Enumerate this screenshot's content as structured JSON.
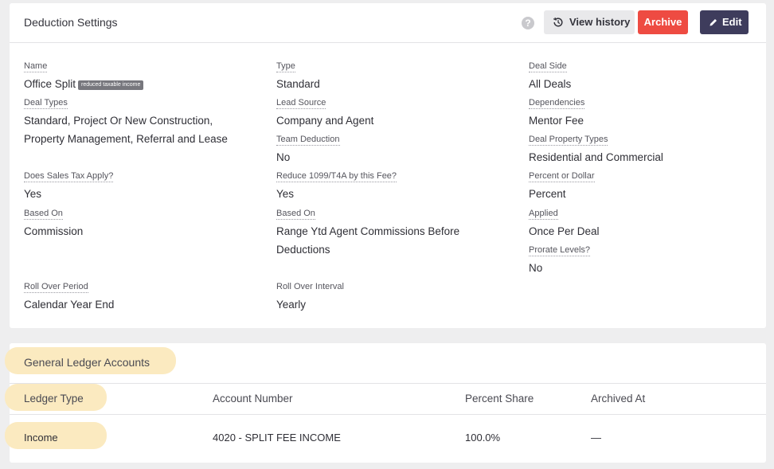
{
  "settings": {
    "title": "Deduction Settings",
    "help_glyph": "?",
    "view_history_label": "View history",
    "archive_label": "Archive",
    "edit_label": "Edit",
    "colors": {
      "archive": "#ee4b42",
      "edit": "#3e3c5c",
      "highlight": "#fbeac0"
    },
    "fields": {
      "name": {
        "label": "Name",
        "value": "Office Split",
        "tag": "reduced taxable income"
      },
      "type": {
        "label": "Type",
        "value": "Standard"
      },
      "deal_side": {
        "label": "Deal Side",
        "value": "All Deals"
      },
      "deal_types": {
        "label": "Deal Types",
        "value_line1": "Standard, Project Or New Construction,",
        "value_line2": "Property Management, Referral and Lease"
      },
      "lead_source": {
        "label": "Lead Source",
        "value": "Company and Agent"
      },
      "dependencies": {
        "label": "Dependencies",
        "value": "Mentor Fee"
      },
      "team_deduction": {
        "label": "Team Deduction",
        "value": "No"
      },
      "deal_property_types": {
        "label": "Deal Property Types",
        "value": "Residential and Commercial"
      },
      "sales_tax": {
        "label": "Does Sales Tax Apply?",
        "value": "Yes"
      },
      "reduce_1099": {
        "label": "Reduce 1099/T4A by this Fee?",
        "value": "Yes"
      },
      "percent_or_dollar": {
        "label": "Percent or Dollar",
        "value": "Percent"
      },
      "based_on_1": {
        "label": "Based On",
        "value": "Commission"
      },
      "based_on_2": {
        "label": "Based On",
        "value_line1": "Range Ytd Agent Commissions Before",
        "value_line2": "Deductions"
      },
      "applied": {
        "label": "Applied",
        "value": "Once Per Deal"
      },
      "prorate_levels": {
        "label": "Prorate Levels?",
        "value": "No"
      },
      "roll_over_period": {
        "label": "Roll Over Period",
        "value": "Calendar Year End"
      },
      "roll_over_interval": {
        "label": "Roll Over Interval",
        "value": "Yearly"
      }
    }
  },
  "ledger": {
    "title": "General Ledger Accounts",
    "columns": [
      "Ledger Type",
      "Account Number",
      "Percent Share",
      "Archived At"
    ],
    "rows": [
      [
        "Income",
        "4020 - SPLIT FEE INCOME",
        "100.0%",
        "—"
      ]
    ]
  }
}
